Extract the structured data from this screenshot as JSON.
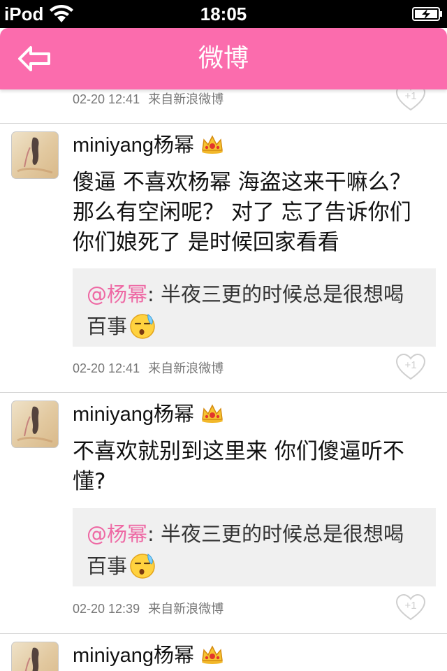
{
  "status_bar": {
    "carrier": "iPod",
    "time": "18:05"
  },
  "nav": {
    "title": "微博",
    "back_icon": "back-arrow-icon"
  },
  "top_meta": {
    "time": "02-20 12:41",
    "source": "来自新浪微博",
    "like_label": "+1"
  },
  "posts": [
    {
      "username": "miniyang杨幂",
      "content": "傻逼 不喜欢杨幂 海盗这来干嘛么？那么有空闲呢？ 对了 忘了告诉你们 你们娘死了 是时候回家看看",
      "repost": {
        "mention": "@杨幂",
        "text": ": 半夜三更的时候总是很想喝百事"
      },
      "time": "02-20 12:41",
      "source": "来自新浪微博",
      "like_label": "+1"
    },
    {
      "username": "miniyang杨幂",
      "content": "不喜欢就别到这里来 你们傻逼听不懂?",
      "repost": {
        "mention": "@杨幂",
        "text": ": 半夜三更的时候总是很想喝百事"
      },
      "time": "02-20 12:39",
      "source": "来自新浪微博",
      "like_label": "+1"
    },
    {
      "username": "miniyang杨幂"
    }
  ],
  "colors": {
    "nav_bg": "#fb6cad",
    "mention": "#ee69a4",
    "repost_bg": "#f0f0f0"
  }
}
